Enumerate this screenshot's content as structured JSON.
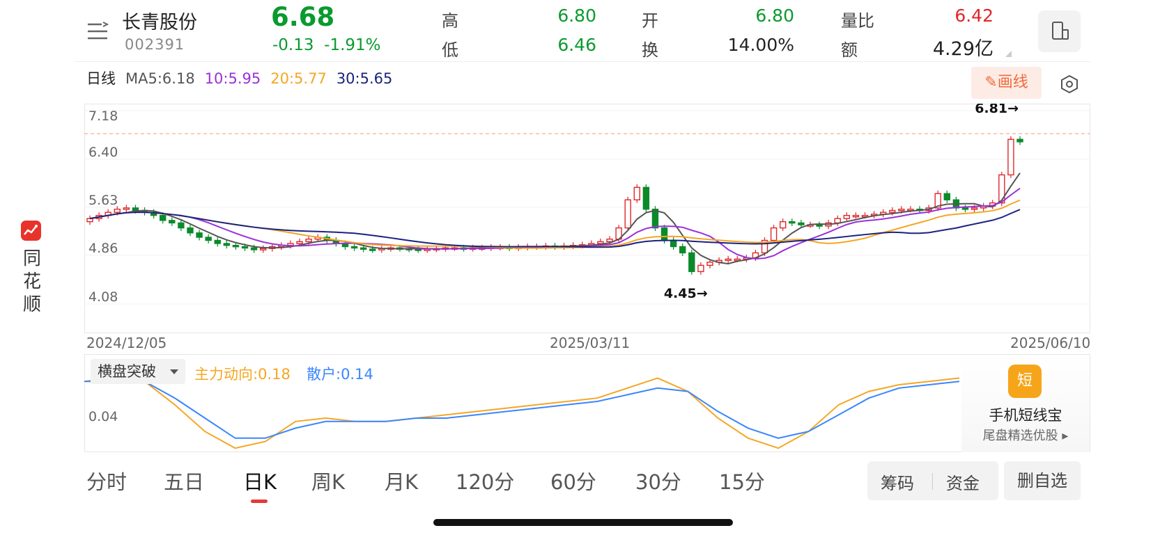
{
  "brand": {
    "text": "同花顺"
  },
  "header": {
    "name": "长青股份",
    "code": "002391",
    "price": "6.68",
    "change": "-0.13",
    "change_pct": "-1.91%",
    "stats": [
      {
        "label": "高",
        "value": "6.80",
        "color": "#0a9a2e"
      },
      {
        "label": "低",
        "value": "6.46",
        "color": "#0a9a2e"
      },
      {
        "label": "开",
        "value": "6.80",
        "color": "#0a9a2e"
      },
      {
        "label": "换",
        "value": "14.00%",
        "color": "#222222"
      },
      {
        "label": "量比",
        "value": "6.42",
        "color": "#e0262a"
      },
      {
        "label": "额",
        "value": "4.29亿",
        "color": "#222222"
      }
    ]
  },
  "ma_bar": {
    "period": "日线",
    "ma5": "MA5:6.18",
    "ma10": "10:5.95",
    "ma20": "20:5.77",
    "ma30": "30:5.65",
    "colors": {
      "ma5": "#555555",
      "ma10": "#9b30d9",
      "ma20": "#f5a623",
      "ma30": "#1a237e"
    },
    "draw_label": "画线"
  },
  "chart_data": {
    "type": "candlestick",
    "y_ticks": [
      "7.18",
      "6.40",
      "5.63",
      "4.86",
      "4.08"
    ],
    "ylim": [
      4.08,
      7.18
    ],
    "x_labels": [
      "2024/12/05",
      "2025/03/11",
      "2025/06/10"
    ],
    "max_marker": "6.81→",
    "min_marker": "4.45→",
    "reference_price": 6.81,
    "up_color": "#e0262a",
    "down_color": "#0a8a2a",
    "closes": [
      5.45,
      5.5,
      5.55,
      5.6,
      5.62,
      5.58,
      5.55,
      5.5,
      5.42,
      5.38,
      5.3,
      5.22,
      5.15,
      5.1,
      5.05,
      5.02,
      5.0,
      4.98,
      4.95,
      4.97,
      5.0,
      5.02,
      5.05,
      5.08,
      5.12,
      5.15,
      5.1,
      5.05,
      5.0,
      4.98,
      4.96,
      4.95,
      4.97,
      4.98,
      4.97,
      4.96,
      4.95,
      4.96,
      4.97,
      4.98,
      4.98,
      4.97,
      4.98,
      4.98,
      4.99,
      4.99,
      4.98,
      4.99,
      5.0,
      5.0,
      5.01,
      5.0,
      5.01,
      5.02,
      5.03,
      5.05,
      5.08,
      5.12,
      5.3,
      5.75,
      5.95,
      5.6,
      5.3,
      5.1,
      5.0,
      4.9,
      4.6,
      4.7,
      4.75,
      4.78,
      4.8,
      4.8,
      4.82,
      4.9,
      5.1,
      5.3,
      5.4,
      5.38,
      5.35,
      5.35,
      5.33,
      5.38,
      5.45,
      5.5,
      5.5,
      5.5,
      5.52,
      5.55,
      5.58,
      5.6,
      5.6,
      5.58,
      5.62,
      5.85,
      5.75,
      5.62,
      5.6,
      5.62,
      5.65,
      5.7,
      6.15,
      6.72,
      6.68
    ]
  },
  "indicator": {
    "name": "横盘突破",
    "main_label": "主力动向:0.18",
    "retail_label": "散户:0.14",
    "y_tick": "0.04",
    "main_color": "#f5a623",
    "retail_color": "#3a86ff",
    "main_values": [
      0.05,
      0.06,
      0.05,
      -0.02,
      -0.1,
      -0.15,
      -0.13,
      -0.07,
      -0.06,
      -0.07,
      -0.07,
      -0.06,
      -0.05,
      -0.04,
      -0.03,
      -0.02,
      -0.01,
      0.0,
      0.03,
      0.06,
      0.02,
      -0.06,
      -0.12,
      -0.15,
      -0.1,
      -0.02,
      0.02,
      0.04,
      0.05,
      0.06
    ],
    "retail_values": [
      0.05,
      0.05,
      0.05,
      0.0,
      -0.06,
      -0.12,
      -0.12,
      -0.09,
      -0.07,
      -0.07,
      -0.07,
      -0.06,
      -0.06,
      -0.05,
      -0.04,
      -0.03,
      -0.02,
      -0.01,
      0.01,
      0.03,
      0.02,
      -0.04,
      -0.09,
      -0.12,
      -0.1,
      -0.05,
      0.0,
      0.03,
      0.04,
      0.05
    ]
  },
  "ad": {
    "title": "手机短线宝",
    "subtitle": "尾盘精选优股 ▸",
    "icon_text": "短"
  },
  "tabs": [
    "分时",
    "五日",
    "日K",
    "周K",
    "月K",
    "120分",
    "60分",
    "30分",
    "15分"
  ],
  "active_tab": "日K",
  "bottom_buttons": {
    "chips": "筹码",
    "funds": "资金",
    "remove": "删自选"
  }
}
